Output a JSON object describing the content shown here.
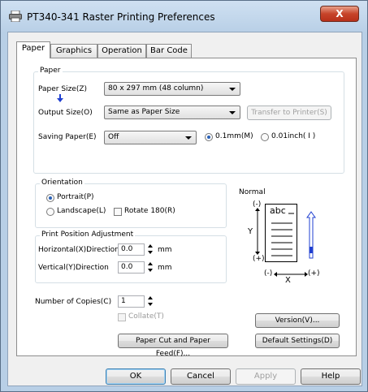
{
  "window": {
    "title": "PT340-341 Raster Printing Preferences",
    "close_label": "X"
  },
  "tabs": [
    {
      "label": "Paper"
    },
    {
      "label": "Graphics"
    },
    {
      "label": "Operation"
    },
    {
      "label": "Bar Code"
    }
  ],
  "paper_group": {
    "title": "Paper",
    "paper_size_label": "Paper Size(Z)",
    "paper_size_value": "80 x 297 mm (48 column)",
    "output_size_label": "Output Size(O)",
    "output_size_value": "Same as Paper Size",
    "transfer_button": "Transfer to Printer(S)",
    "saving_paper_label": "Saving Paper(E)",
    "saving_paper_value": "Off",
    "unit_mm_label": "0.1mm(M)",
    "unit_inch_label": "0.01inch( I )"
  },
  "orientation_group": {
    "title": "Orientation",
    "portrait_label": "Portrait(P)",
    "landscape_label": "Landscape(L)",
    "rotate_label": "Rotate 180(R)"
  },
  "print_position_group": {
    "title": "Print Position Adjustment",
    "horizontal_label": "Horizontal(X)Direction",
    "horizontal_value": "0.0",
    "vertical_label": "Vertical(Y)Direction",
    "vertical_value": "0.0",
    "unit": "mm"
  },
  "preview": {
    "mode_label": "Normal",
    "sample_text": "abc",
    "y_minus": "(-)",
    "y_label": "Y",
    "y_plus": "(+)",
    "x_minus": "(-)",
    "x_label": "X",
    "x_plus": "(+)"
  },
  "copies": {
    "label": "Number of Copies(C)",
    "value": "1",
    "collate_label": "Collate(T)"
  },
  "buttons": {
    "version": "Version(V)...",
    "paper_cut": "Paper Cut and Paper Feed(F)...",
    "default_settings": "Default Settings(D)",
    "ok": "OK",
    "cancel": "Cancel",
    "apply": "Apply",
    "help": "Help"
  },
  "colors": {
    "accent": "#2a62b8",
    "arrow_blue": "#1f3fd0",
    "close_red": "#c7442a"
  }
}
